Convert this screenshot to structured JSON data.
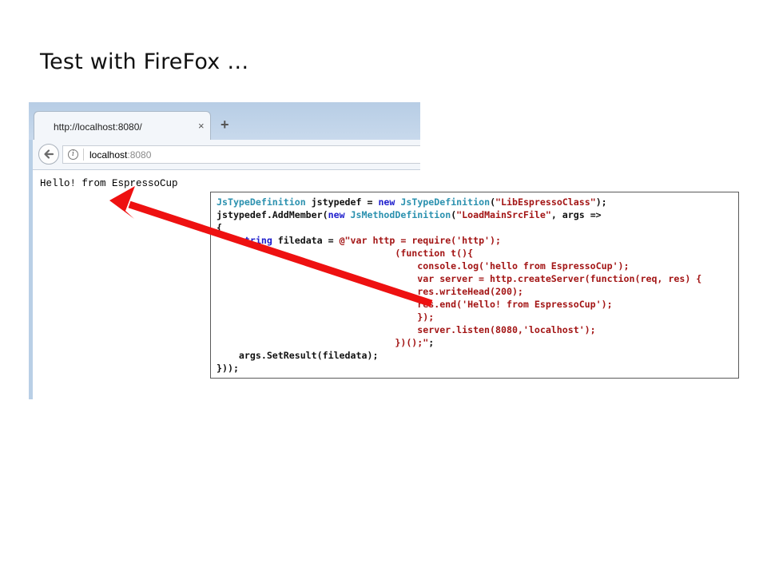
{
  "slide": {
    "title": "Test with FireFox …"
  },
  "browser": {
    "tab_title": "http://localhost:8080/",
    "tab_close": "×",
    "new_tab": "+",
    "url_host": "localhost",
    "url_port": ":8080",
    "page_text": "Hello! from EspressoCup"
  },
  "code": {
    "lines": [
      [
        {
          "c": "t",
          "v": "JsTypeDefinition"
        },
        {
          "c": "",
          "v": " jstypedef = "
        },
        {
          "c": "k",
          "v": "new"
        },
        {
          "c": "",
          "v": " "
        },
        {
          "c": "t",
          "v": "JsTypeDefinition"
        },
        {
          "c": "",
          "v": "("
        },
        {
          "c": "s",
          "v": "\"LibEspressoClass\""
        },
        {
          "c": "",
          "v": ");"
        }
      ],
      [
        {
          "c": "",
          "v": "jstypedef.AddMember("
        },
        {
          "c": "k",
          "v": "new"
        },
        {
          "c": "",
          "v": " "
        },
        {
          "c": "t",
          "v": "JsMethodDefinition"
        },
        {
          "c": "",
          "v": "("
        },
        {
          "c": "s",
          "v": "\"LoadMainSrcFile\""
        },
        {
          "c": "",
          "v": ", args =>"
        }
      ],
      [
        {
          "c": "",
          "v": "{"
        }
      ],
      [
        {
          "c": "",
          "v": "    "
        },
        {
          "c": "k",
          "v": "string"
        },
        {
          "c": "",
          "v": " filedata = "
        },
        {
          "c": "s",
          "v": "@\"var http = require('http');"
        }
      ],
      [
        {
          "c": "s",
          "v": "                                (function t(){"
        }
      ],
      [
        {
          "c": "s",
          "v": "                                    console.log('hello from EspressoCup');"
        }
      ],
      [
        {
          "c": "s",
          "v": "                                    var server = http.createServer(function(req, res) {"
        }
      ],
      [
        {
          "c": "s",
          "v": "                                    res.writeHead(200);"
        }
      ],
      [
        {
          "c": "s",
          "v": "                                    res.end('Hello! from EspressoCup');"
        }
      ],
      [
        {
          "c": "s",
          "v": "                                    });"
        }
      ],
      [
        {
          "c": "s",
          "v": "                                    server.listen(8080,'localhost');"
        }
      ],
      [
        {
          "c": "s",
          "v": "                                })();\""
        },
        {
          "c": "",
          "v": ";"
        }
      ],
      [
        {
          "c": "",
          "v": "    args.SetResult(filedata);"
        }
      ],
      [
        {
          "c": "",
          "v": "}));"
        }
      ]
    ]
  },
  "colors": {
    "arrow": "#ee1111",
    "keyword": "#1c1ccc",
    "type": "#2b91af",
    "string": "#a31515"
  }
}
